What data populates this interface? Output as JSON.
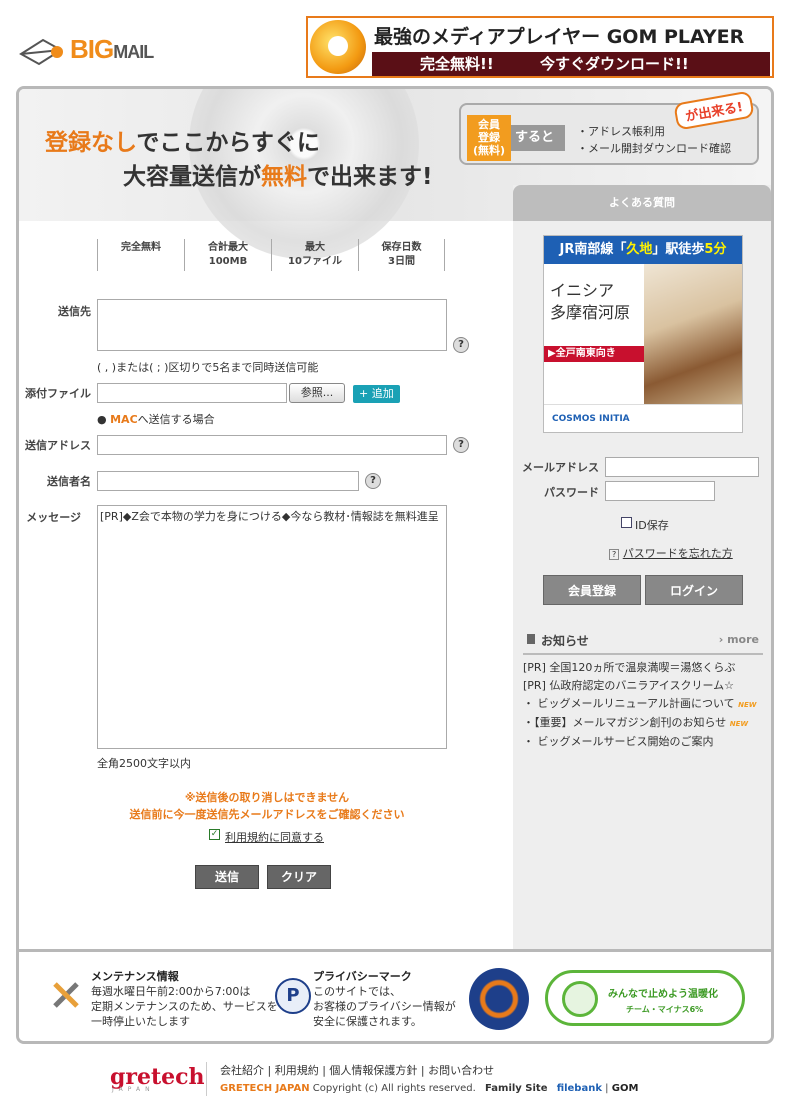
{
  "header": {
    "logo": {
      "big": "BIG",
      "mail": "MAIL"
    },
    "ad": {
      "title": "最強のメディアプレイヤー GOM PLAYER",
      "left": "完全無料!!",
      "right": "今すぐダウンロード!!"
    }
  },
  "banner": {
    "line1_orange": "登録なし",
    "line1_rest": "でここからすぐに",
    "line2_pre": "大容量送信が",
    "line2_orange": "無料",
    "line2_post": "で出来ます!",
    "reg_tag": [
      "会員",
      "登録",
      "(無料)"
    ],
    "reg_arrow": "すると",
    "reg_items": [
      "・アドレス帳利用",
      "・メール開封ダウンロード確認"
    ],
    "reg_can": "が出来る!"
  },
  "stats": [
    {
      "l1": "完全無料",
      "l2": ""
    },
    {
      "l1": "合計最大",
      "l2": "100MB"
    },
    {
      "l1": "最大",
      "l2": "10ファイル"
    },
    {
      "l1": "保存日数",
      "l2": "3日間"
    }
  ],
  "form": {
    "to_label": "送信先",
    "to_hint": "( , )または( ; )区切りで5名まで同時送信可能",
    "attach_label": "添付ファイル",
    "browse": "参照...",
    "add": "+ 追加",
    "mac_prefix": "MAC",
    "mac_hint": "へ送信する場合",
    "from_label": "送信アドレス",
    "sender_label": "送信者名",
    "message_label": "メッセージ",
    "message_value": "[PR]◆Z会で本物の学力を身につける◆今なら教材･情報誌を無料進呈",
    "message_limit": "全角2500文字以内",
    "warn1": "※送信後の取り消しはできません",
    "warn2": "送信前に今一度送信先メールアドレスをご確認ください",
    "agree": "利用規約に同意する",
    "send": "送信",
    "clear": "クリア",
    "help": "?"
  },
  "side": {
    "faq": "よくある質問",
    "ad": {
      "top_a": "JR南部線「",
      "top_b": "久地",
      "top_c": "」駅徒歩",
      "top_d": "5分",
      "name1": "イニシア",
      "name2": "多摩宿河原",
      "red": "▶全戸南東向き",
      "brand": "COSMOS INITIA"
    },
    "mail_label": "メールアドレス",
    "pass_label": "パスワード",
    "save_id": "ID保存",
    "forgot": "パスワードを忘れた方",
    "register": "会員登録",
    "login": "ログイン",
    "notice_title": "お知らせ",
    "more": "more",
    "notices": [
      {
        "text": "[PR] 全国120ヵ所で温泉満喫＝湯悠くらぶ",
        "new": ""
      },
      {
        "text": "[PR] 仏政府認定のバニラアイスクリーム☆",
        "new": ""
      },
      {
        "text": "・ ビッグメールリニューアル計画について",
        "new": "NEW"
      },
      {
        "text": "・【重要】メールマガジン創刊のお知らせ",
        "new": "NEW"
      },
      {
        "text": "・ ビッグメールサービス開始のご案内",
        "new": ""
      }
    ]
  },
  "infobar": {
    "maint_title": "メンテナンス情報",
    "maint_lines": [
      "毎週水曜日午前2:00から7:00は",
      "定期メンテナンスのため、サービスを",
      "一時停止いたします"
    ],
    "privacy_title": "プライバシーマーク",
    "privacy_lines": [
      "このサイトでは、",
      "お客様のプライバシー情報が",
      "安全に保護されます。"
    ],
    "eco1": "みんなで止めよう温暖化",
    "eco2": "チーム・マイナス6%"
  },
  "footer": {
    "brand": "gretech",
    "brand_sub": "JAPAN",
    "links": "会社紹介 | 利用規約 | 個人情報保護方針 | お問い合わせ",
    "copy_brand": "GRETECH JAPAN",
    "copy": " Copyright (c) All rights reserved.",
    "family": "Family Site",
    "filebank": "filebank",
    "gom": "GOM"
  },
  "colors": {
    "accent": "#e87a1a",
    "frame": "#b8b8b8",
    "side_bg": "#eeeeee",
    "link_blue": "#1e60b4"
  }
}
